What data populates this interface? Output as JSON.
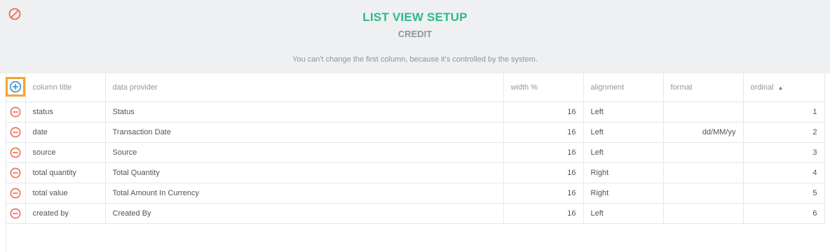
{
  "header": {
    "title": "LIST VIEW SETUP",
    "subtitle": "CREDIT",
    "info": "You can't change the first column, because it's controlled by the system."
  },
  "table": {
    "columns": {
      "column_title": "column title",
      "data_provider": "data provider",
      "width": "width %",
      "alignment": "alignment",
      "format": "format",
      "ordinal": "ordinal"
    },
    "sort": {
      "column": "ordinal",
      "direction": "ascending"
    },
    "rows": [
      {
        "title": "status",
        "provider": "Status",
        "width": "16",
        "alignment": "Left",
        "format": "",
        "ordinal": "1"
      },
      {
        "title": "date",
        "provider": "Transaction Date",
        "width": "16",
        "alignment": "Left",
        "format": "dd/MM/yy",
        "ordinal": "2"
      },
      {
        "title": "source",
        "provider": "Source",
        "width": "16",
        "alignment": "Left",
        "format": "",
        "ordinal": "3"
      },
      {
        "title": "total quantity",
        "provider": "Total Quantity",
        "width": "16",
        "alignment": "Right",
        "format": "",
        "ordinal": "4"
      },
      {
        "title": "total value",
        "provider": "Total Amount In Currency",
        "width": "16",
        "alignment": "Right",
        "format": "",
        "ordinal": "5"
      },
      {
        "title": "created by",
        "provider": "Created By",
        "width": "16",
        "alignment": "Left",
        "format": "",
        "ordinal": "6"
      }
    ]
  },
  "colors": {
    "accent": "#2fb98a",
    "remove": "#ef6a55",
    "add": "#2f8fd8",
    "highlight": "#f6a42c"
  },
  "icons": {
    "cancel": "cancel-icon",
    "add": "add-column-icon",
    "remove": "remove-row-icon",
    "sort": "sort-ascending-icon"
  }
}
